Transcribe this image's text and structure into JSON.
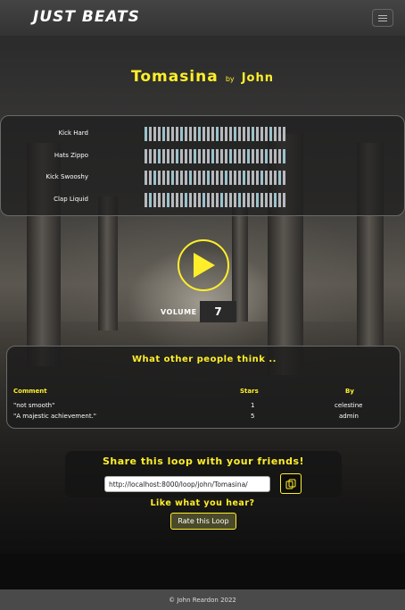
{
  "navbar": {
    "brand": "JUST BEATS",
    "menu_icon": "hamburger-icon"
  },
  "loop": {
    "title": "Tomasina",
    "by_label": "by",
    "artist": "John"
  },
  "tracks": [
    {
      "name": "Kick Hard"
    },
    {
      "name": "Hats Zippo"
    },
    {
      "name": "Kick Swooshy"
    },
    {
      "name": "Clap Liquid"
    }
  ],
  "player": {
    "play_icon": "play-icon",
    "volume_label": "VOLUME",
    "volume_value": "7"
  },
  "reviews": {
    "title": "What other people think ..",
    "headers": {
      "comment": "Comment",
      "stars": "Stars",
      "by": "By"
    },
    "rows": [
      {
        "comment": "\"not smooth\"",
        "stars": "1",
        "by": "celestine"
      },
      {
        "comment": "\"A majestic achievement.\"",
        "stars": "5",
        "by": "admin"
      }
    ]
  },
  "share": {
    "title": "Share this loop with your friends!",
    "url": "http://localhost:8000/loop/john/Tomasina/",
    "copy_icon": "copy-icon",
    "like_text": "Like what you hear?",
    "rate_label": "Rate this Loop"
  },
  "footer": {
    "text": "© John Reardon 2022"
  },
  "colors": {
    "accent": "#ffef2a",
    "navbar": "#3a3a3a",
    "footer": "#4a4a4a"
  }
}
